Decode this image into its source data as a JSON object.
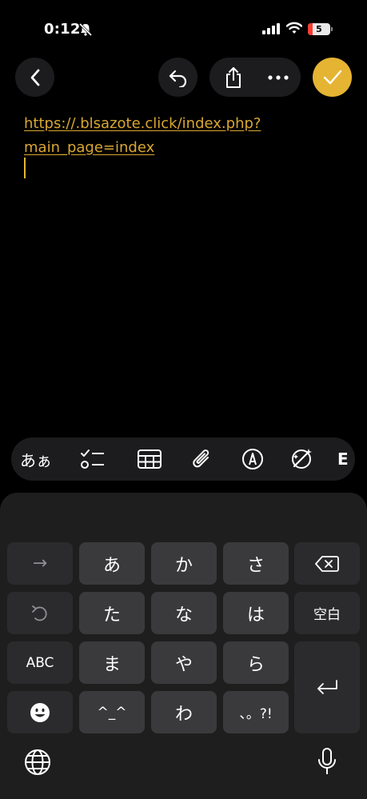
{
  "status_bar": {
    "time": "0:12",
    "battery_level": "5",
    "icons": [
      "bell-slash-icon",
      "signal-icon",
      "wifi-icon",
      "battery-icon"
    ]
  },
  "toolbar": {
    "icons": [
      "chevron-left-icon",
      "undo-icon",
      "share-icon",
      "more-icon",
      "checkmark-icon"
    ]
  },
  "note": {
    "link_line1": "https://.blsazote.click/index.php?",
    "link_line2": "main_page=index"
  },
  "format_bar": {
    "text_style_label": "あぁ",
    "icons": [
      "checklist-icon",
      "table-icon",
      "paperclip-icon",
      "markup-icon",
      "apple-intelligence-icon",
      "more-cutoff-icon"
    ],
    "cutoff_glyph": "E"
  },
  "keyboard": {
    "row1": {
      "arrow": "→",
      "k1": "あ",
      "k2": "か",
      "k3": "さ"
    },
    "row2": {
      "k1": "た",
      "k2": "な",
      "k3": "は",
      "space": "空白"
    },
    "row3": {
      "abc": "ABC",
      "k1": "ま",
      "k2": "や",
      "k3": "ら"
    },
    "row4": {
      "k1": "^_^",
      "k2": "わ",
      "k3": "、。?!"
    },
    "icons": [
      "delete-icon",
      "undo-key-icon",
      "return-icon",
      "emoji-icon",
      "globe-icon",
      "microphone-icon"
    ]
  },
  "colors": {
    "accent": "#e6b433",
    "link": "#d9a733",
    "key": "#3a3a3c",
    "key_function": "#2b2b2d",
    "background": "#000000"
  }
}
